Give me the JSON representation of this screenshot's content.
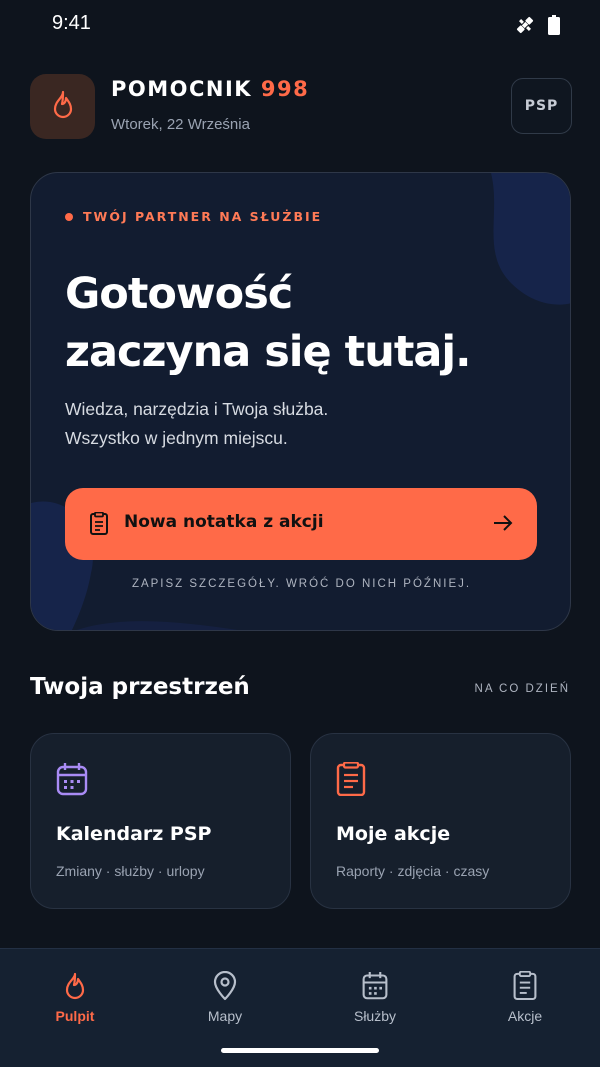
{
  "status_bar": {
    "time": "9:41",
    "icons": [
      "satellite-icon",
      "battery-icon"
    ]
  },
  "header": {
    "title_main": "POMOCNIK",
    "title_accent": "998",
    "date": "Wtorek, 22 Września",
    "badge": "PSP",
    "app_icon": "flame-icon"
  },
  "hero": {
    "kicker": "TWÓJ PARTNER NA SŁUŻBIE",
    "headline_line1": "Gotowość",
    "headline_line2": "zaczyna się tutaj.",
    "sub_line1": "Wiedza, narzędzia i Twoja służba.",
    "sub_line2": "Wszystko w jednym miejscu.",
    "cta_label": "Nowa notatka z akcji",
    "hint": "ZAPISZ SZCZEGÓŁY. WRÓĆ DO NICH PÓŹNIEJ."
  },
  "section": {
    "title": "Twoja przestrzeń",
    "aside": "NA CO DZIEŃ",
    "tiles": [
      {
        "title": "Kalendarz PSP",
        "subtitle": "Zmiany · służby · urlopy",
        "icon": "calendar-icon"
      },
      {
        "title": "Moje akcje",
        "subtitle": "Raporty · zdjęcia · czasy",
        "icon": "document-icon"
      }
    ]
  },
  "nav": {
    "items": [
      {
        "label": "Pulpit",
        "icon": "flame-icon",
        "active": true
      },
      {
        "label": "Mapy",
        "icon": "map-pin-icon",
        "active": false
      },
      {
        "label": "Służby",
        "icon": "calendar-icon",
        "active": false
      },
      {
        "label": "Akcje",
        "icon": "document-icon",
        "active": false
      }
    ]
  },
  "colors": {
    "accent": "#ff6a48",
    "background": "#0e141d",
    "card": "#121c30",
    "tile_calendar_icon": "#a98bf5"
  }
}
